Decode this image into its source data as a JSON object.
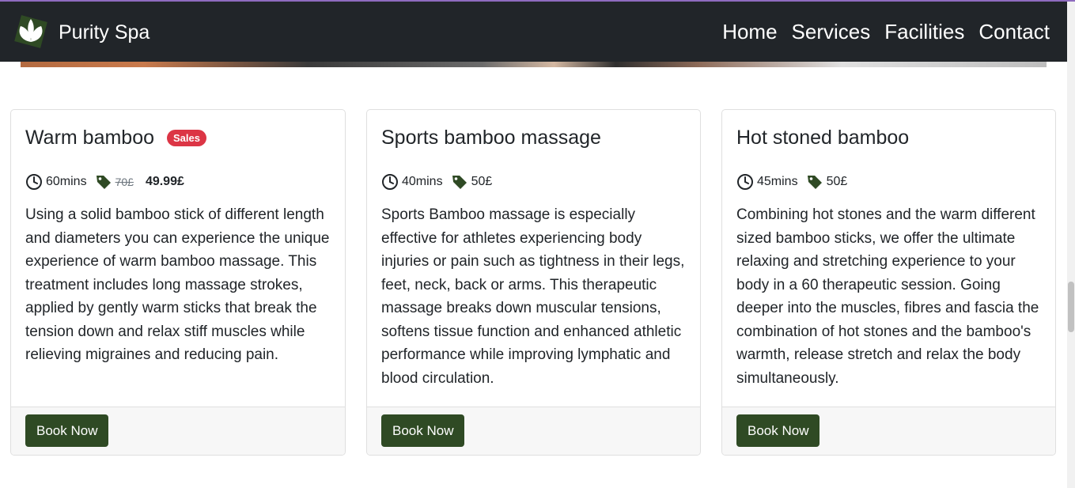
{
  "brand": {
    "name": "Purity Spa",
    "logo_icon": "leaf-logo-icon",
    "logo_bg": "#2f4a24"
  },
  "nav": {
    "items": [
      {
        "label": "Home"
      },
      {
        "label": "Services"
      },
      {
        "label": "Facilities"
      },
      {
        "label": "Contact"
      }
    ]
  },
  "colors": {
    "navbar": "#212529",
    "button": "#2f4a24",
    "badge": "#dc3545",
    "icon": "#2f4a24"
  },
  "cards": [
    {
      "title": "Warm bamboo",
      "badge": "Sales",
      "duration": "60mins",
      "price_old": "70£",
      "price": "49.99£",
      "description": "Using a solid bamboo stick of different length and diameters you can experience the unique experience of warm bamboo massage. This treatment includes long massage strokes, applied by gently warm sticks that break the tension down and relax stiff muscles while relieving migraines and reducing pain.",
      "button_label": "Book Now"
    },
    {
      "title": "Sports bamboo massage",
      "duration": "40mins",
      "price": "50£",
      "description": "Sports Bamboo massage is especially effective for athletes experiencing body injuries or pain such as tightness in their legs, feet, neck, back or arms. This therapeutic massage breaks down muscular tensions, softens tissue function and enhanced athletic performance while improving lymphatic and blood circulation.",
      "button_label": "Book Now"
    },
    {
      "title": "Hot stoned bamboo",
      "duration": "45mins",
      "price": "50£",
      "description": "Combining hot stones and the warm different sized bamboo sticks, we offer the ultimate relaxing and stretching experience to your body in a 60 therapeutic session. Going deeper into the muscles, fibres and fascia the combination of hot stones and the bamboo's warmth, release stretch and relax the body simultaneously.",
      "button_label": "Book Now"
    }
  ]
}
